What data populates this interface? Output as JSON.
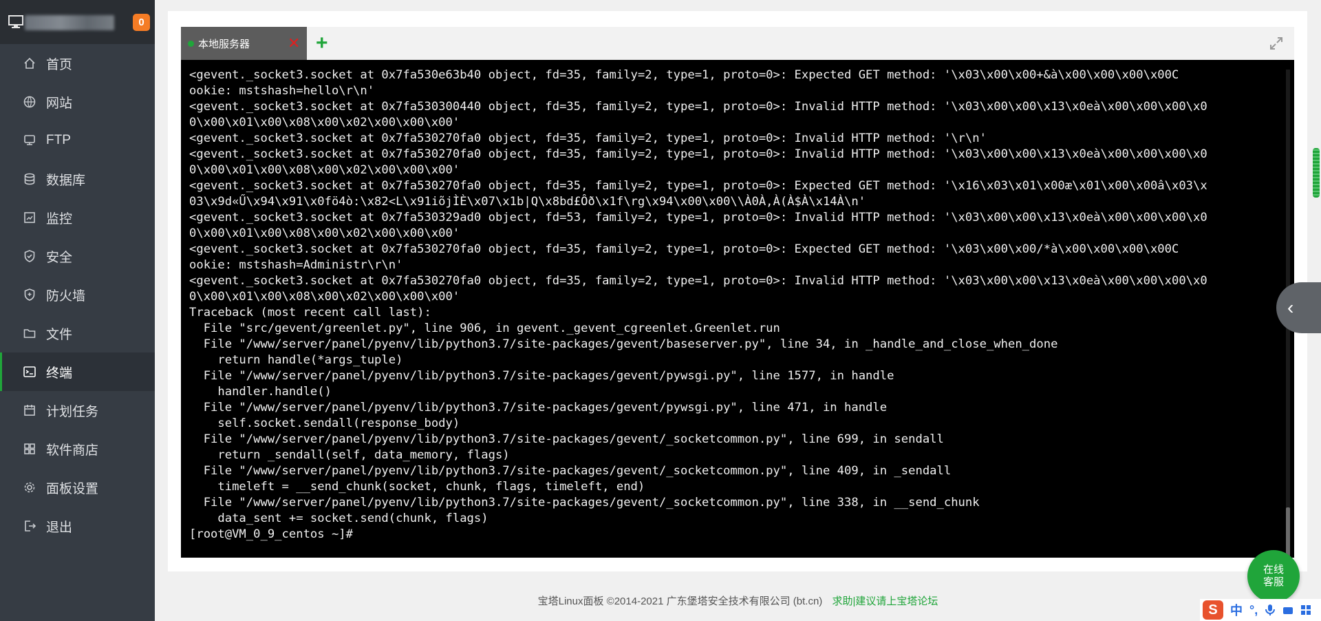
{
  "header": {
    "unread_count": "0"
  },
  "nav": [
    {
      "label": "首页",
      "icon": "home-icon"
    },
    {
      "label": "网站",
      "icon": "globe-icon"
    },
    {
      "label": "FTP",
      "icon": "ftp-icon"
    },
    {
      "label": "数据库",
      "icon": "database-icon"
    },
    {
      "label": "监控",
      "icon": "monitor-chart-icon"
    },
    {
      "label": "安全",
      "icon": "shield-icon"
    },
    {
      "label": "防火墙",
      "icon": "firewall-icon"
    },
    {
      "label": "文件",
      "icon": "folder-icon"
    },
    {
      "label": "终端",
      "icon": "terminal-icon",
      "active": true
    },
    {
      "label": "计划任务",
      "icon": "calendar-icon"
    },
    {
      "label": "软件商店",
      "icon": "apps-icon"
    },
    {
      "label": "面板设置",
      "icon": "gear-icon"
    },
    {
      "label": "退出",
      "icon": "logout-icon"
    }
  ],
  "terminal": {
    "tab_label": "本地服务器",
    "lines": [
      "<gevent._socket3.socket at 0x7fa530e63b40 object, fd=35, family=2, type=1, proto=0>: Expected GET method: '\\x03\\x00\\x00+&à\\x00\\x00\\x00\\x00C",
      "ookie: mstshash=hello\\r\\n'",
      "<gevent._socket3.socket at 0x7fa530300440 object, fd=35, family=2, type=1, proto=0>: Invalid HTTP method: '\\x03\\x00\\x00\\x13\\x0eà\\x00\\x00\\x00\\x0",
      "0\\x00\\x01\\x00\\x08\\x00\\x02\\x00\\x00\\x00'",
      "<gevent._socket3.socket at 0x7fa530270fa0 object, fd=35, family=2, type=1, proto=0>: Invalid HTTP method: '\\r\\n'",
      "<gevent._socket3.socket at 0x7fa530270fa0 object, fd=35, family=2, type=1, proto=0>: Invalid HTTP method: '\\x03\\x00\\x00\\x13\\x0eà\\x00\\x00\\x00\\x0",
      "0\\x00\\x01\\x00\\x08\\x00\\x02\\x00\\x00\\x00'",
      "<gevent._socket3.socket at 0x7fa530270fa0 object, fd=35, family=2, type=1, proto=0>: Expected GET method: '\\x16\\x03\\x01\\x00æ\\x01\\x00\\x00â\\x03\\x",
      "03\\x9d«Ű\\x94\\x91\\x0fö4ò:\\x82<L\\x91iõjÌÈ\\x07\\x1b|Q\\x8bd£Ôð\\x1f\\rg\\x94\\x00\\x00\\\\À0À,À(À$À\\x14À\\n'",
      "<gevent._socket3.socket at 0x7fa530329ad0 object, fd=53, family=2, type=1, proto=0>: Invalid HTTP method: '\\x03\\x00\\x00\\x13\\x0eà\\x00\\x00\\x00\\x0",
      "0\\x00\\x01\\x00\\x08\\x00\\x02\\x00\\x00\\x00'",
      "<gevent._socket3.socket at 0x7fa530270fa0 object, fd=35, family=2, type=1, proto=0>: Expected GET method: '\\x03\\x00\\x00/*à\\x00\\x00\\x00\\x00C",
      "ookie: mstshash=Administr\\r\\n'",
      "<gevent._socket3.socket at 0x7fa530270fa0 object, fd=35, family=2, type=1, proto=0>: Invalid HTTP method: '\\x03\\x00\\x00\\x13\\x0eà\\x00\\x00\\x00\\x0",
      "0\\x00\\x01\\x00\\x08\\x00\\x02\\x00\\x00\\x00'",
      "Traceback (most recent call last):",
      "  File \"src/gevent/greenlet.py\", line 906, in gevent._gevent_cgreenlet.Greenlet.run",
      "  File \"/www/server/panel/pyenv/lib/python3.7/site-packages/gevent/baseserver.py\", line 34, in _handle_and_close_when_done",
      "    return handle(*args_tuple)",
      "  File \"/www/server/panel/pyenv/lib/python3.7/site-packages/gevent/pywsgi.py\", line 1577, in handle",
      "    handler.handle()",
      "  File \"/www/server/panel/pyenv/lib/python3.7/site-packages/gevent/pywsgi.py\", line 471, in handle",
      "    self.socket.sendall(response_body)",
      "  File \"/www/server/panel/pyenv/lib/python3.7/site-packages/gevent/_socketcommon.py\", line 699, in sendall",
      "    return _sendall(self, data_memory, flags)",
      "  File \"/www/server/panel/pyenv/lib/python3.7/site-packages/gevent/_socketcommon.py\", line 409, in _sendall",
      "    timeleft = __send_chunk(socket, chunk, flags, timeleft, end)",
      "  File \"/www/server/panel/pyenv/lib/python3.7/site-packages/gevent/_socketcommon.py\", line 338, in __send_chunk",
      "    data_sent += socket.send(chunk, flags)",
      "[root@VM_0_9_centos ~]#"
    ]
  },
  "footer": {
    "copyright": "宝塔Linux面板 ©2014-2021 广东堡塔安全技术有限公司 (bt.cn)",
    "forum_link": "求助|建议请上宝塔论坛"
  },
  "online_chat": {
    "line1": "在线",
    "line2": "客服"
  },
  "ime": {
    "logo": "S",
    "lang": "中",
    "punct": "°,"
  },
  "colors": {
    "accent": "#20a53a",
    "sidebar": "#363c44",
    "badge": "#f57c25"
  }
}
